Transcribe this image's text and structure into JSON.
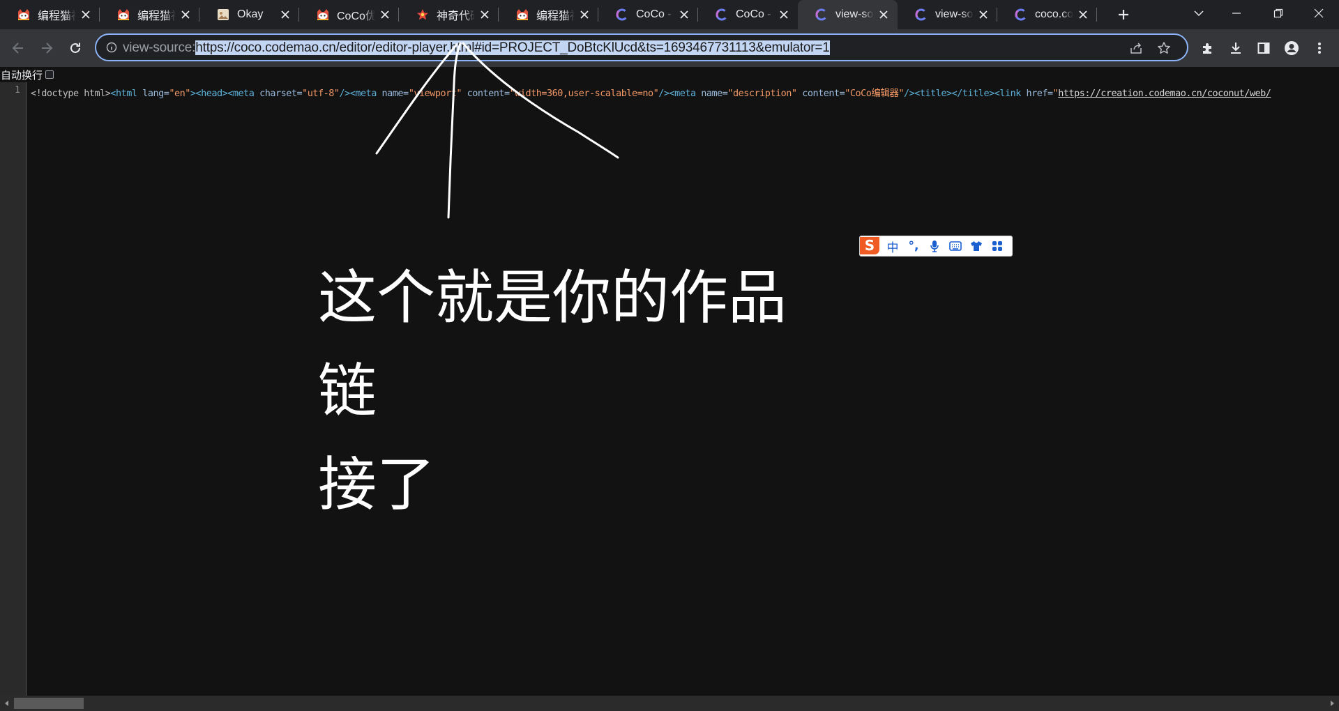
{
  "tabs": [
    {
      "title": "编程猫社区",
      "icon": "codemao-cat-icon",
      "active": false
    },
    {
      "title": "编程猫社区",
      "icon": "codemao-cat-icon",
      "active": false
    },
    {
      "title": "Okay",
      "icon": "image-thumb-icon",
      "active": false
    },
    {
      "title": "CoCo优秀作品",
      "icon": "codemao-cat-icon",
      "active": false
    },
    {
      "title": "神奇代码岛",
      "icon": "code-island-icon",
      "active": false
    },
    {
      "title": "编程猫社区",
      "icon": "codemao-cat-icon",
      "active": false
    },
    {
      "title": "CoCo - i",
      "icon": "coco-c-icon",
      "active": false
    },
    {
      "title": "CoCo - i",
      "icon": "coco-c-icon",
      "active": false
    },
    {
      "title": "view-source",
      "icon": "coco-c-icon",
      "active": true
    },
    {
      "title": "view-source",
      "icon": "coco-c-icon",
      "active": false
    },
    {
      "title": "coco.codemao",
      "icon": "coco-c-icon",
      "active": false
    }
  ],
  "address_bar": {
    "scheme": "view-source:",
    "url": "https://coco.codemao.cn/editor/editor-player.html#id=PROJECT_DoBtcKlUcd&ts=1693467731113&emulator=1"
  },
  "line_wrap": {
    "label": "自动换行",
    "checked": false
  },
  "source": {
    "line_number": "1",
    "tokens": [
      {
        "t": "<!doctype html>",
        "c": "doc"
      },
      {
        "t": "<html ",
        "c": "tag"
      },
      {
        "t": "lang=",
        "c": "attr"
      },
      {
        "t": "\"en\"",
        "c": "val"
      },
      {
        "t": ">",
        "c": "tag"
      },
      {
        "t": "<head>",
        "c": "tag"
      },
      {
        "t": "<meta ",
        "c": "tag"
      },
      {
        "t": "charset=",
        "c": "attr"
      },
      {
        "t": "\"utf-8\"",
        "c": "val"
      },
      {
        "t": "/>",
        "c": "tag"
      },
      {
        "t": "<meta ",
        "c": "tag"
      },
      {
        "t": "name=",
        "c": "attr"
      },
      {
        "t": "\"viewport\" ",
        "c": "val"
      },
      {
        "t": "content=",
        "c": "attr"
      },
      {
        "t": "\"width=360,user-scalable=no\"",
        "c": "val"
      },
      {
        "t": "/>",
        "c": "tag"
      },
      {
        "t": "<meta ",
        "c": "tag"
      },
      {
        "t": "name=",
        "c": "attr"
      },
      {
        "t": "\"description\" ",
        "c": "val"
      },
      {
        "t": "content=",
        "c": "attr"
      },
      {
        "t": "\"CoCo编辑器\"",
        "c": "val"
      },
      {
        "t": "/>",
        "c": "tag"
      },
      {
        "t": "<title>",
        "c": "tag"
      },
      {
        "t": "</title>",
        "c": "tag"
      },
      {
        "t": "<link ",
        "c": "tag"
      },
      {
        "t": "href=",
        "c": "attr"
      },
      {
        "t": "\"",
        "c": "val"
      },
      {
        "t": "https://creation.codemao.cn/coconut/web/",
        "c": "link"
      }
    ]
  },
  "annotation": {
    "text_line1": "这个就是你的作品链",
    "text_line2": "接了",
    "stroke_color": "#ffffff"
  },
  "ime_toolbar": {
    "items": [
      {
        "label": "中",
        "icon": "chinese-mode-icon"
      },
      {
        "label": "°,",
        "icon": "punctuation-icon"
      },
      {
        "label": "",
        "icon": "microphone-icon"
      },
      {
        "label": "",
        "icon": "keyboard-icon"
      },
      {
        "label": "",
        "icon": "skin-shirt-icon"
      },
      {
        "label": "",
        "icon": "toolbox-grid-icon"
      }
    ],
    "brand_color": "#f05a23"
  },
  "colors": {
    "accent": "#8ab4f8",
    "tab_bg": "#202124",
    "toolbar_bg": "#35363a",
    "page_bg": "#121212"
  }
}
